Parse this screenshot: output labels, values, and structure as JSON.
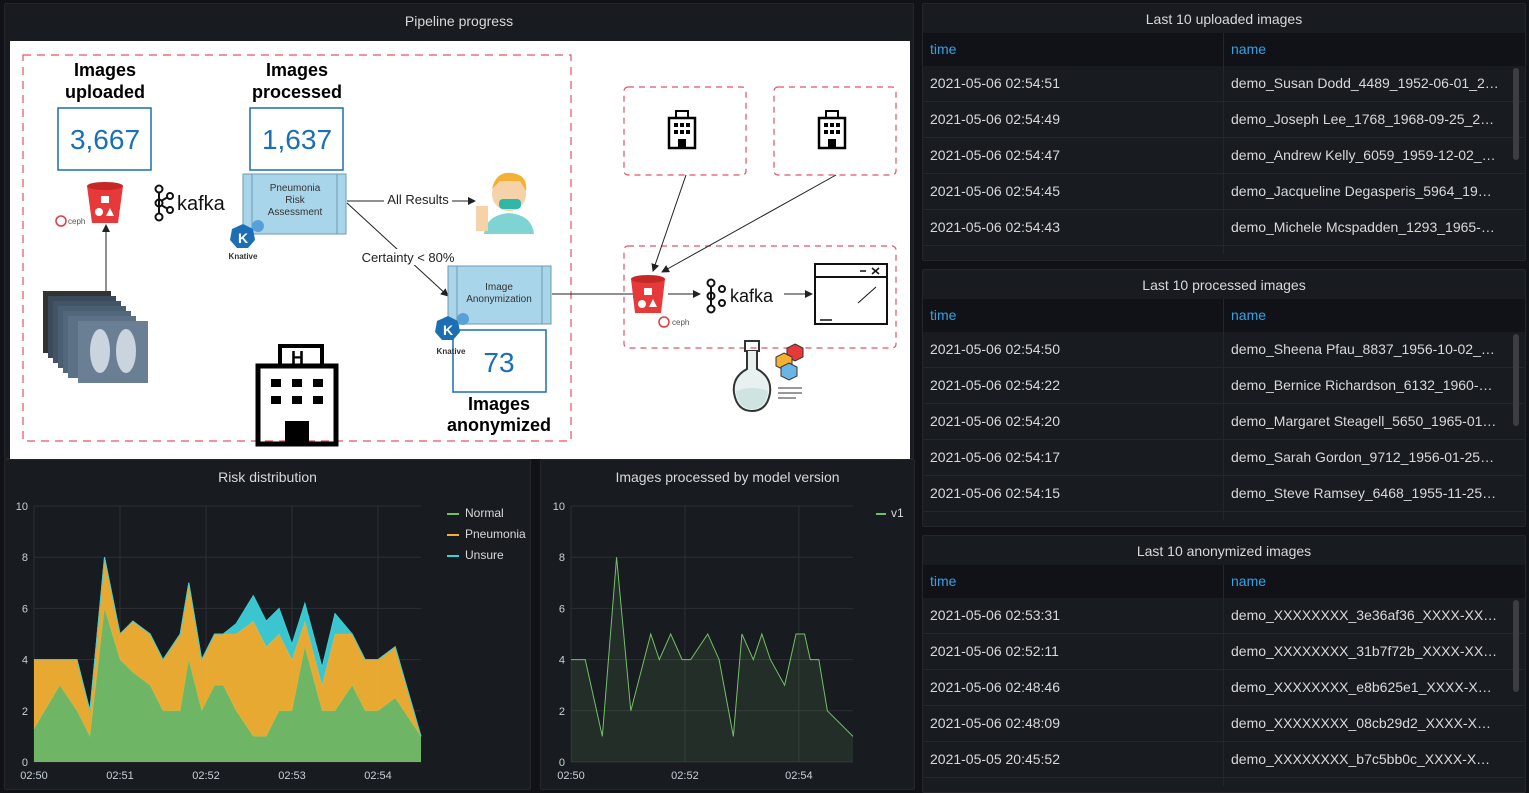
{
  "panels": {
    "pipeline_title": "Pipeline progress",
    "risk_title": "Risk distribution",
    "model_title": "Images processed by model version",
    "uploaded_title": "Last 10 uploaded images",
    "processed_title": "Last 10 processed images",
    "anonymized_title": "Last 10 anonymized images"
  },
  "diagram": {
    "uploaded_label_1": "Images",
    "uploaded_label_2": "uploaded",
    "uploaded_count": "3,667",
    "processed_label_1": "Images",
    "processed_label_2": "processed",
    "processed_count": "1,637",
    "anonymized_count": "73",
    "anonymized_label_1": "Images",
    "anonymized_label_2": "anonymized",
    "kafka": "kafka",
    "ceph": "ceph",
    "knative": "Knative",
    "pneumonia_box": [
      "Pneumonia",
      "Risk",
      "Assessment"
    ],
    "anonymization_box": [
      "Image",
      "Anonymization"
    ],
    "all_results": "All Results",
    "certainty": "Certainty < 80%",
    "accent": "#1a6fb5"
  },
  "tables": {
    "col_time": "time",
    "col_name": "name",
    "uploaded": [
      [
        "2021-05-06 02:54:51",
        "demo_Susan Dodd_4489_1952-06-01_20…"
      ],
      [
        "2021-05-06 02:54:49",
        "demo_Joseph Lee_1768_1968-09-25_201…"
      ],
      [
        "2021-05-06 02:54:47",
        "demo_Andrew Kelly_6059_1959-12-02_2…"
      ],
      [
        "2021-05-06 02:54:45",
        "demo_Jacqueline Degasperis_5964_1947…"
      ],
      [
        "2021-05-06 02:54:43",
        "demo_Michele Mcspadden_1293_1965-1…"
      ]
    ],
    "processed": [
      [
        "2021-05-06 02:54:50",
        "demo_Sheena Pfau_8837_1956-10-02_20…"
      ],
      [
        "2021-05-06 02:54:22",
        "demo_Bernice Richardson_6132_1960-03…"
      ],
      [
        "2021-05-06 02:54:20",
        "demo_Margaret Steagell_5650_1965-01-…"
      ],
      [
        "2021-05-06 02:54:17",
        "demo_Sarah Gordon_9712_1956-01-25_2…"
      ],
      [
        "2021-05-06 02:54:15",
        "demo_Steve Ramsey_6468_1955-11-25_2…"
      ]
    ],
    "anonymized": [
      [
        "2021-05-06 02:53:31",
        "demo_XXXXXXXX_3e36af36_XXXX-XX-X…"
      ],
      [
        "2021-05-06 02:52:11",
        "demo_XXXXXXXX_31b7f72b_XXXX-XX-X…"
      ],
      [
        "2021-05-06 02:48:46",
        "demo_XXXXXXXX_e8b625e1_XXXX-XX-X…"
      ],
      [
        "2021-05-06 02:48:09",
        "demo_XXXXXXXX_08cb29d2_XXXX-XX-X…"
      ],
      [
        "2021-05-05 20:45:52",
        "demo_XXXXXXXX_b7c5bb0c_XXXX-XX-X…"
      ]
    ]
  },
  "chart_data": [
    {
      "type": "area",
      "title": "Risk distribution",
      "stacked": true,
      "ylim": [
        0,
        10
      ],
      "yticks": [
        "0",
        "2",
        "4",
        "6",
        "8",
        "10"
      ],
      "xticks": [
        {
          "x": 0,
          "label": "02:50"
        },
        {
          "x": 1,
          "label": "02:51"
        },
        {
          "x": 2,
          "label": "02:52"
        },
        {
          "x": 3,
          "label": "02:53"
        },
        {
          "x": 4,
          "label": "02:54"
        }
      ],
      "x": [
        0,
        0.3,
        0.5,
        0.65,
        0.82,
        1.0,
        1.15,
        1.35,
        1.5,
        1.7,
        1.8,
        1.95,
        2.1,
        2.2,
        2.35,
        2.55,
        2.7,
        2.85,
        3.0,
        3.15,
        3.35,
        3.5,
        3.7,
        3.85,
        4.0,
        4.2,
        4.5
      ],
      "legend_position": "right",
      "grid": true,
      "series": [
        {
          "name": "Normal",
          "color": "#73bf69",
          "values": [
            1.3,
            3.0,
            2.0,
            1.0,
            6.0,
            4.0,
            3.5,
            3.0,
            2.0,
            2.0,
            4.0,
            2.0,
            3.0,
            3.0,
            2.0,
            1.0,
            1.0,
            2.0,
            2.0,
            4.5,
            2.0,
            2.0,
            3.0,
            2.0,
            2.0,
            2.5,
            1.0
          ]
        },
        {
          "name": "Pneumonia",
          "color": "#f2b134",
          "values": [
            2.7,
            1.0,
            2.0,
            1.0,
            2.0,
            1.0,
            2.0,
            2.0,
            2.0,
            3.0,
            3.0,
            2.0,
            2.0,
            2.0,
            3.0,
            4.5,
            3.5,
            3.0,
            2.0,
            1.0,
            1.0,
            3.0,
            2.0,
            2.0,
            2.0,
            2.0,
            0.0
          ]
        },
        {
          "name": "Unsure",
          "color": "#3ccfd9",
          "values": [
            0,
            0,
            0,
            0,
            0,
            0,
            0,
            0,
            0,
            0,
            0,
            0,
            0,
            0,
            0.4,
            1.0,
            1.0,
            1.0,
            0.6,
            0.7,
            0.7,
            0.8,
            0.0,
            0,
            0,
            0,
            0
          ]
        }
      ]
    },
    {
      "type": "line",
      "title": "Images processed by model version",
      "ylim": [
        0,
        10
      ],
      "yticks": [
        "0",
        "2",
        "4",
        "6",
        "8",
        "10"
      ],
      "xticks": [
        {
          "x": 0,
          "label": "02:50"
        },
        {
          "x": 2,
          "label": "02:52"
        },
        {
          "x": 4,
          "label": "02:54"
        }
      ],
      "legend_position": "top-right",
      "grid": true,
      "x": [
        0,
        0.25,
        0.55,
        0.8,
        1.05,
        1.4,
        1.55,
        1.75,
        1.95,
        2.1,
        2.4,
        2.6,
        2.85,
        3.0,
        3.2,
        3.35,
        3.5,
        3.75,
        3.95,
        4.1,
        4.2,
        4.35,
        4.5,
        4.95
      ],
      "series": [
        {
          "name": "v1",
          "color": "#73bf69",
          "values": [
            4,
            4,
            1,
            8,
            2,
            5,
            4,
            5,
            4,
            4,
            5,
            4,
            1,
            5,
            4,
            5,
            4,
            3,
            5,
            5,
            4,
            4,
            2,
            1
          ]
        }
      ]
    }
  ]
}
